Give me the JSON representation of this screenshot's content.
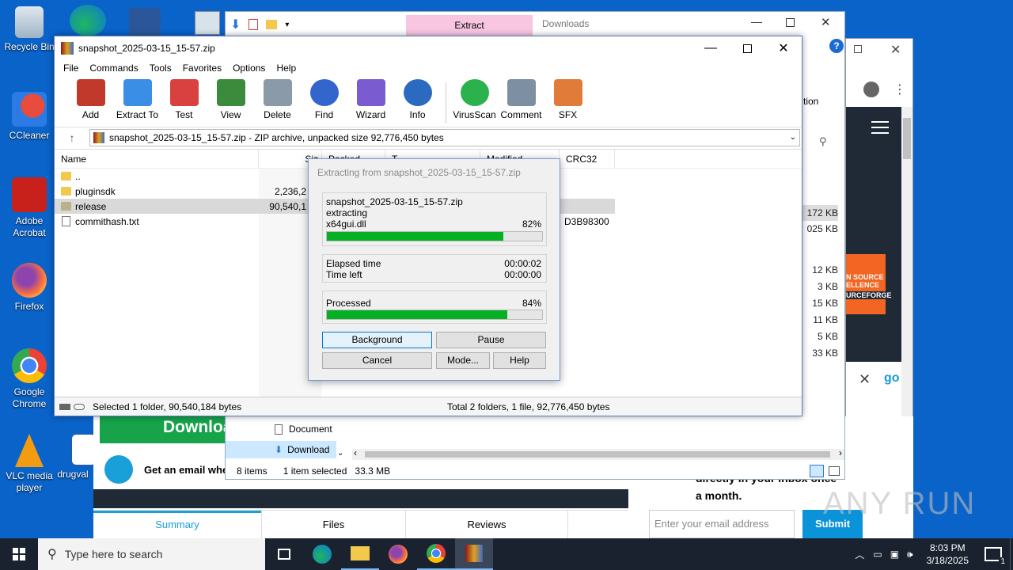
{
  "desktop": {
    "icons": [
      {
        "label": "Recycle Bin"
      },
      {
        "label": "CCleaner"
      },
      {
        "label": "Adobe Acrobat"
      },
      {
        "label": "Firefox"
      },
      {
        "label": "Google Chrome"
      },
      {
        "label": "VLC media player"
      },
      {
        "label": "drugval"
      }
    ]
  },
  "explorer_bg": {
    "ribbon_tab_active": "Extract",
    "ribbon_tab_title": "Downloads",
    "ribbon_partial": "tion",
    "sizes": [
      "172 KB",
      "025 KB",
      "12 KB",
      "3 KB",
      "15 KB",
      "11 KB",
      "5 KB",
      "33 KB"
    ],
    "nav_items": [
      "Document",
      "Download"
    ],
    "status_items": "8 items",
    "status_selected": "1 item selected",
    "status_size": "33.3 MB"
  },
  "browser_bg": {
    "download_banner": "Downloa",
    "email_prompt": "Get an email whe",
    "newsletter_text_1": "directly in your inbox once",
    "newsletter_text_2": "a month.",
    "email_placeholder": "Enter your email address",
    "submit_label": "Submit",
    "tabs": [
      "Summary",
      "Files",
      "Reviews"
    ],
    "badge_line1": "N SOURCE",
    "badge_line2": "ELLENCE",
    "badge_line3": "URCEFORGE",
    "partial_go": "go"
  },
  "winrar": {
    "title": "snapshot_2025-03-15_15-57.zip",
    "menu": [
      "File",
      "Commands",
      "Tools",
      "Favorites",
      "Options",
      "Help"
    ],
    "tools": [
      {
        "label": "Add",
        "color": "#c0392b"
      },
      {
        "label": "Extract To",
        "color": "#3a8ee6"
      },
      {
        "label": "Test",
        "color": "#d94040"
      },
      {
        "label": "View",
        "color": "#3c8a3c"
      },
      {
        "label": "Delete",
        "color": "#8a9aa8"
      },
      {
        "label": "Find",
        "color": "#3366cc"
      },
      {
        "label": "Wizard",
        "color": "#7a5bd0"
      },
      {
        "label": "Info",
        "color": "#2a6ac0"
      },
      {
        "label": "VirusScan",
        "color": "#2bb24c"
      },
      {
        "label": "Comment",
        "color": "#7d8fa3"
      },
      {
        "label": "SFX",
        "color": "#e07b39"
      }
    ],
    "address": "snapshot_2025-03-15_15-57.zip - ZIP archive, unpacked size 92,776,450 bytes",
    "columns": [
      "Name",
      "Siz",
      "Packed",
      "T",
      "Modified",
      "CRC32"
    ],
    "rows": [
      {
        "name": "..",
        "size": "",
        "crc": "",
        "kind": "up"
      },
      {
        "name": "pluginsdk",
        "size": "2,236,2",
        "crc": "",
        "kind": "folder"
      },
      {
        "name": "release",
        "size": "90,540,1",
        "crc": "",
        "kind": "folder"
      },
      {
        "name": "commithash.txt",
        "size": "",
        "crc": "D3B98300",
        "kind": "file"
      }
    ],
    "status_left": "Selected 1 folder, 90,540,184 bytes",
    "status_right": "Total 2 folders, 1 file, 92,776,450 bytes"
  },
  "extract_dialog": {
    "title": "Extracting from snapshot_2025-03-15_15-57.zip",
    "archive": "snapshot_2025-03-15_15-57.zip",
    "action": "extracting",
    "current_file": "x64gui.dll",
    "file_percent_label": "82%",
    "file_progress": 0.82,
    "elapsed_label": "Elapsed time",
    "elapsed_value": "00:00:02",
    "left_label": "Time left",
    "left_value": "00:00:00",
    "processed_label": "Processed",
    "processed_percent_label": "84%",
    "processed_progress": 0.84,
    "buttons": {
      "background": "Background",
      "pause": "Pause",
      "cancel": "Cancel",
      "mode": "Mode...",
      "help": "Help"
    }
  },
  "taskbar": {
    "search_placeholder": "Type here to search",
    "time": "8:03 PM",
    "date": "3/18/2025",
    "notification_count": "1"
  },
  "watermark": "ANY RUN"
}
